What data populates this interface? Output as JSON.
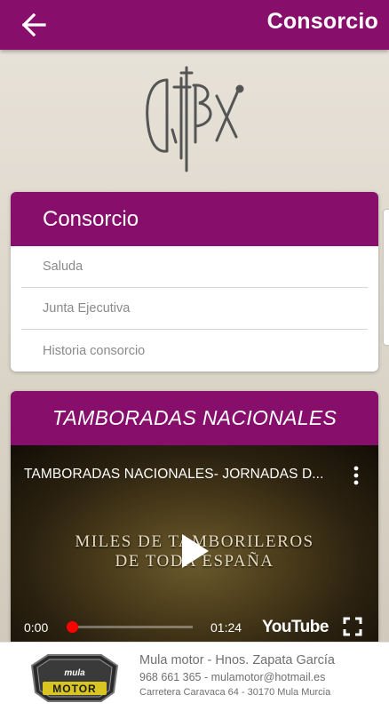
{
  "header": {
    "title": "Consorcio",
    "color": "#870f6b"
  },
  "logo": {
    "text": "CTBX"
  },
  "menu_card": {
    "title": "Consorcio",
    "items": [
      {
        "label": "Saluda"
      },
      {
        "label": "Junta Ejecutiva"
      },
      {
        "label": "Historia consorcio"
      }
    ]
  },
  "video_card": {
    "title": "TAMBORADAS NACIONALES",
    "video": {
      "title": "TAMBORADAS NACIONALES- JORNADAS D...",
      "overlay_line1": "MILES DE TAMBORILEROS",
      "overlay_line2": "DE TODA ESPAÑA",
      "current_time": "0:00",
      "duration": "01:24",
      "progress": 0,
      "brand": "YouTube"
    }
  },
  "sponsor": {
    "logo_top": "mula",
    "logo_main": "MOTOR",
    "name": "Mula motor - Hnos. Zapata García",
    "contact": "968 661 365 - mulamotor@hotmail.es",
    "address": "Carretera Caravaca 64 - 30170 Mula Murcia"
  }
}
